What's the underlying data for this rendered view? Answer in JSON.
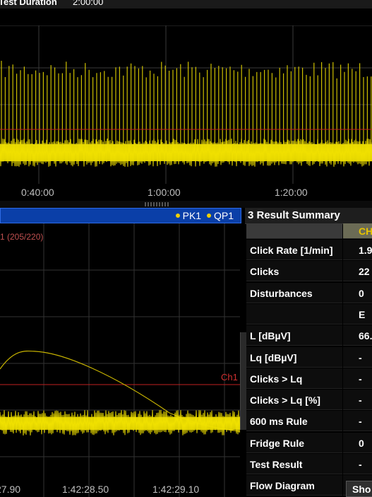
{
  "top_bar": {
    "label": "Test Duration",
    "value": "2:00:00"
  },
  "top_trace": {
    "x_tick_labels": [
      "0:40:00",
      "1:00:00",
      "1:20:00"
    ],
    "trace_color": "#f0e000",
    "limit_color": "#c02020"
  },
  "lower_window": {
    "legend": [
      "PK1",
      "QP1"
    ],
    "limit_label": "1 (205/220)",
    "channel_label": "Ch1",
    "x_tick_labels": [
      "27.90",
      "1:42:28.50",
      "1:42:29.10"
    ],
    "header_color": "#0a3fa8"
  },
  "result_summary": {
    "title": "3 Result Summary",
    "column_header": "CH",
    "rows": [
      {
        "label": "Click Rate [1/min]",
        "value": "1.9"
      },
      {
        "label": "Clicks",
        "value": "22"
      },
      {
        "label": "Disturbances",
        "value": "0"
      },
      {
        "label": "",
        "value": "E"
      },
      {
        "label": "L [dBµV]",
        "value": "66."
      },
      {
        "label": "Lq [dBµV]",
        "value": "-"
      },
      {
        "label": "Clicks > Lq",
        "value": "-"
      },
      {
        "label": "Clicks > Lq [%]",
        "value": "-"
      },
      {
        "label": "600 ms Rule",
        "value": "-"
      },
      {
        "label": "Fridge Rule",
        "value": "0"
      },
      {
        "label": "Test Result",
        "value": "-"
      },
      {
        "label": "Flow Diagram",
        "value": ""
      }
    ],
    "flow_button": "Sho"
  }
}
